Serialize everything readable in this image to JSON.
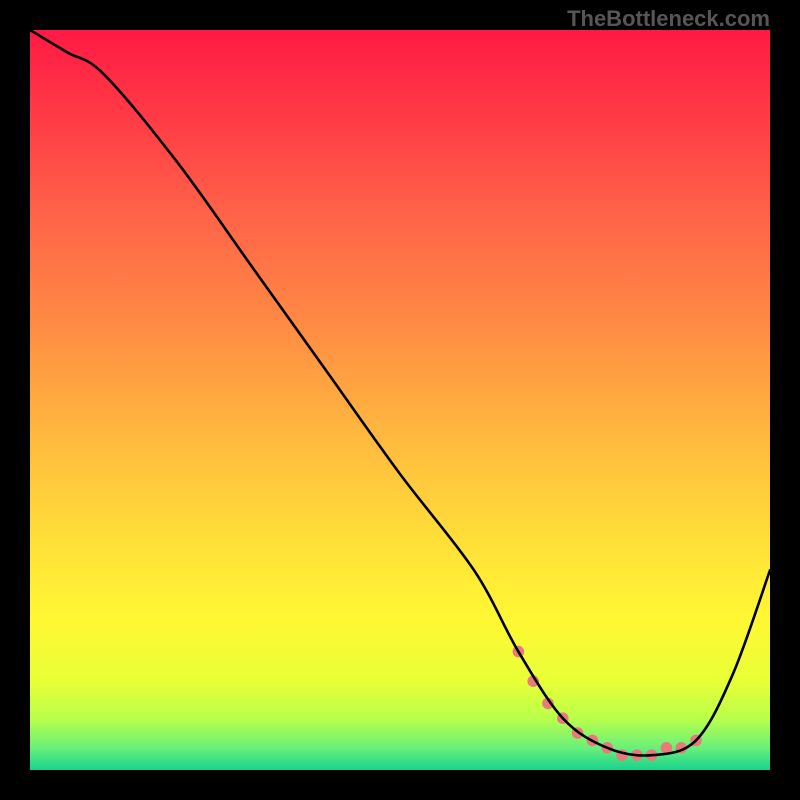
{
  "watermark": "TheBottleneck.com",
  "chart_data": {
    "type": "line",
    "title": "",
    "xlabel": "",
    "ylabel": "",
    "xlim": [
      0,
      100
    ],
    "ylim": [
      0,
      100
    ],
    "grid": false,
    "series": [
      {
        "name": "curve",
        "x": [
          0,
          5,
          10,
          20,
          30,
          40,
          50,
          60,
          66,
          72,
          78,
          84,
          90,
          95,
          100
        ],
        "y": [
          100,
          97,
          94,
          82,
          68,
          54,
          40,
          27,
          16,
          7,
          3,
          2,
          4,
          13,
          27
        ]
      }
    ],
    "marker_band": {
      "x": [
        66,
        68,
        70,
        72,
        74,
        76,
        78,
        80,
        82,
        84,
        86,
        88,
        90
      ],
      "y": [
        16,
        12,
        9,
        7,
        5,
        4,
        3,
        2,
        2,
        2,
        3,
        3,
        4
      ],
      "color": "#e77b7b"
    },
    "background_gradient": {
      "stops": [
        {
          "offset": 0.0,
          "color": "#ff1a44"
        },
        {
          "offset": 0.12,
          "color": "#ff3b46"
        },
        {
          "offset": 0.25,
          "color": "#ff6348"
        },
        {
          "offset": 0.4,
          "color": "#ff8b44"
        },
        {
          "offset": 0.55,
          "color": "#ffb93e"
        },
        {
          "offset": 0.7,
          "color": "#ffe238"
        },
        {
          "offset": 0.8,
          "color": "#fff833"
        },
        {
          "offset": 0.88,
          "color": "#e8ff36"
        },
        {
          "offset": 0.93,
          "color": "#baff4a"
        },
        {
          "offset": 0.97,
          "color": "#6af07a"
        },
        {
          "offset": 1.0,
          "color": "#17d38f"
        }
      ]
    }
  }
}
